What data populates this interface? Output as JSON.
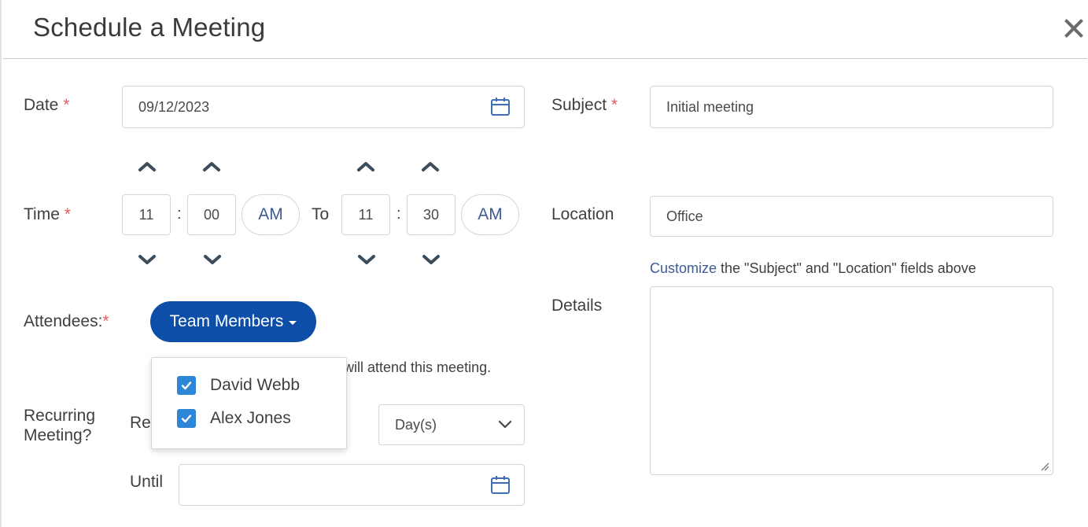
{
  "dialog": {
    "title": "Schedule a Meeting",
    "close_icon": "close-icon"
  },
  "date": {
    "label": "Date",
    "required": "*",
    "value": "09/12/2023",
    "icon": "calendar-icon"
  },
  "time": {
    "label": "Time",
    "required": "*",
    "start": {
      "hour": "11",
      "minute": "00",
      "ampm": "AM"
    },
    "separator": ":",
    "to_label": "To",
    "end": {
      "hour": "11",
      "minute": "30",
      "ampm": "AM"
    },
    "up_icon": "chevron-up-icon",
    "down_icon": "chevron-down-icon"
  },
  "attendees": {
    "label": "Attendees:",
    "required": "*",
    "button_label": "Team Members",
    "hint_partial": "will attend this meeting.",
    "options": [
      {
        "label": "David Webb",
        "checked": true
      },
      {
        "label": "Alex Jones",
        "checked": true
      }
    ]
  },
  "recurring": {
    "label_line1": "Recurring",
    "label_line2": "Meeting?",
    "repeat_partial": "Rep",
    "unit_value": "Day(s)",
    "until_label": "Until",
    "until_value": ""
  },
  "subject": {
    "label": "Subject",
    "required": "*",
    "value": "Initial meeting"
  },
  "location": {
    "label": "Location",
    "value": "Office",
    "customize_link": "Customize",
    "customize_text": " the \"Subject\" and \"Location\" fields above"
  },
  "details": {
    "label": "Details",
    "value": ""
  },
  "colors": {
    "primary_button": "#0d4fa8",
    "checkbox": "#2e86d6",
    "link": "#3e5b93",
    "required": "#e35d5d"
  }
}
